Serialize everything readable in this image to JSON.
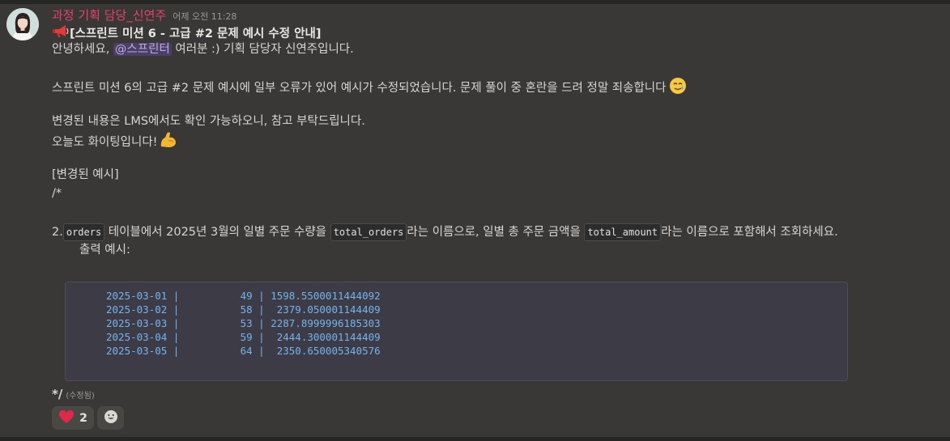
{
  "message": {
    "author": "과정 기획 담당_신연주",
    "timestamp": "어제 오전 11:28",
    "title": "[스프린트 미션 6 - 고급 #2 문제 예시 수정 안내]",
    "greeting_prefix": "안녕하세요, ",
    "mention": "@스프린터",
    "greeting_suffix": " 여러분 :) 기획 담당자 신연주입니다.",
    "paragraph_1": "스프린트 미션 6의 고급 #2 문제 예시에 일부 오류가 있어 예시가 수정되었습니다. 문제 풀이 중 혼란을 드려 정말 죄송합니다",
    "paragraph_2": "변경된 내용은 LMS에서도 확인 가능하오니, 참고 부탁드립니다.",
    "paragraph_3": "오늘도 화이팅입니다!",
    "changed_example_label": " [변경된 예시]",
    "comment_open": "/*",
    "task": {
      "number": "2. ",
      "code_orders": "orders",
      "text_1": " 테이블에서 2025년 3월의 일별 주문 수량을 ",
      "code_total_orders": "total_orders",
      "text_2": "라는 이름으로, 일별 총 주문 금액을 ",
      "code_total_amount": "total_amount",
      "text_3": "라는 이름으로 포함해서 조회하세요.",
      "output_label": "출력 예시:"
    },
    "code_lines": [
      "2025-03-01 |          49 | 1598.5500011444092",
      "2025-03-02 |          58 |  2379.050001144409",
      "2025-03-03 |          53 | 2287.8999996185303",
      "2025-03-04 |          59 |  2444.300001144409",
      "2025-03-05 |          64 |  2350.650005340576"
    ],
    "comment_close": "*/",
    "edited_label": "(수정됨)"
  },
  "reactions": {
    "heart_count": "2"
  },
  "icons": {
    "megaphone": "megaphone-icon",
    "tear_smile": "smiling-face-with-tear-icon",
    "flexed_bicep": "flexed-biceps-icon",
    "heart": "heart-icon",
    "add_reaction": "add-reaction-icon"
  },
  "colors": {
    "background": "#393836",
    "author": "#e4426c",
    "mention": "#c3a5ee",
    "code": "#74b3ef"
  }
}
